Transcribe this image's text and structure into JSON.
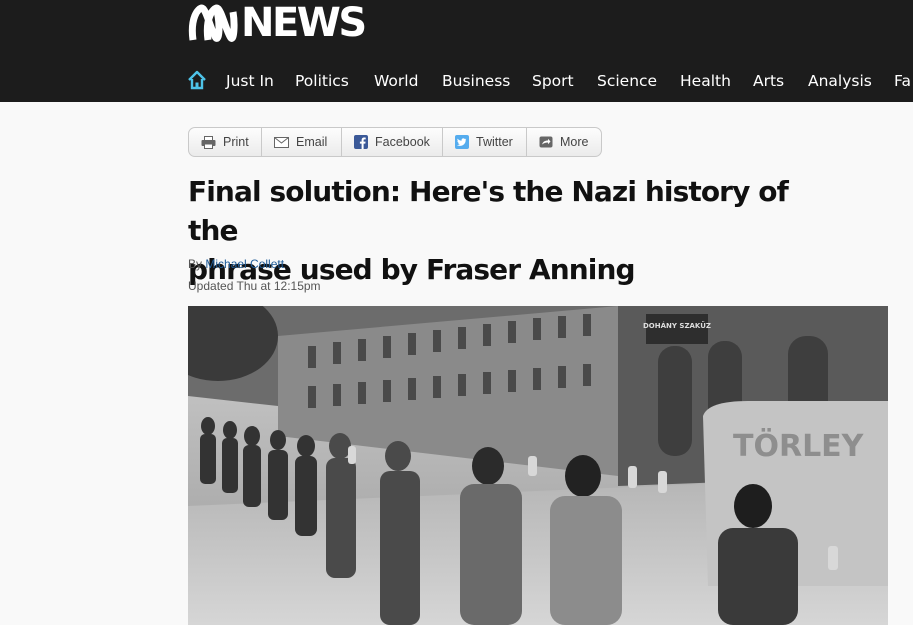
{
  "header": {
    "logo_text": "NEWS",
    "nav_items": [
      "Just In",
      "Politics",
      "World",
      "Business",
      "Sport",
      "Science",
      "Health",
      "Arts",
      "Analysis",
      "Fa"
    ]
  },
  "share": {
    "print": "Print",
    "email": "Email",
    "facebook": "Facebook",
    "twitter": "Twitter",
    "more": "More"
  },
  "article": {
    "headline_line1": "Final solution: Here's the Nazi history of the",
    "headline_line2": "phrase used by Fraser Anning",
    "byline_prefix": "By",
    "author": "Michael Collett",
    "updated": "Updated Thu at 12:15pm",
    "image_sign_1": "DOHÁNY SZAKÜZ",
    "image_sign_2": "TÖRLEY"
  },
  "colors": {
    "header_bg": "#1c1c1c",
    "home_icon": "#4ec3e8",
    "facebook": "#3b5998",
    "twitter": "#55acee",
    "link": "#1f5b97"
  }
}
